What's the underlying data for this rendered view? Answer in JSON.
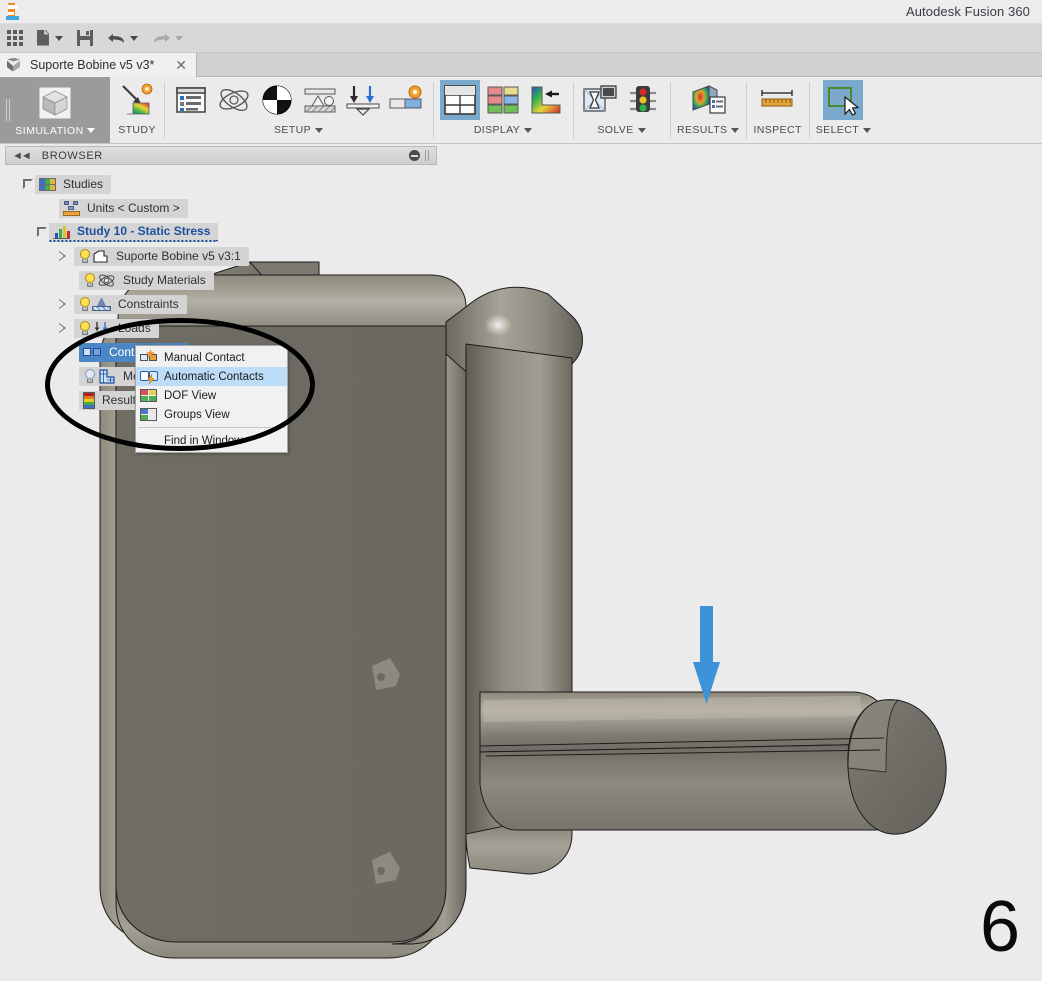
{
  "app": {
    "title": "Autodesk Fusion 360",
    "logo_icon": "fusion-logo-icon"
  },
  "quick_access": {
    "items": [
      {
        "name": "app-grid-button",
        "icon": "grid-icon",
        "label": ""
      },
      {
        "name": "new-document-button",
        "icon": "document-icon",
        "label": "",
        "has_dropdown": true
      },
      {
        "name": "save-button",
        "icon": "save-icon",
        "label": ""
      },
      {
        "name": "undo-button",
        "icon": "undo-arrow-icon",
        "label": "",
        "has_dropdown": true
      },
      {
        "name": "redo-button",
        "icon": "redo-arrow-icon",
        "label": "",
        "has_dropdown": true
      }
    ]
  },
  "tabs": [
    {
      "label": "Suporte Bobine v5 v3*",
      "close_label": "✕",
      "active": true
    }
  ],
  "ribbon": {
    "workspace": {
      "label": "SIMULATION",
      "icon": "cube-icon",
      "has_dropdown": true
    },
    "groups": [
      {
        "label": "STUDY",
        "has_dropdown": false,
        "buttons": [
          {
            "name": "new-study-button",
            "icon": "study-icon"
          }
        ]
      },
      {
        "label": "SETUP",
        "has_dropdown": true,
        "buttons": [
          {
            "name": "simplify-button",
            "icon": "list-panel-icon"
          },
          {
            "name": "study-materials-button",
            "icon": "atom-icon"
          },
          {
            "name": "contacts-button",
            "icon": "contact-sphere-icon"
          },
          {
            "name": "constraints-button",
            "icon": "constraint-icon"
          },
          {
            "name": "loads-button",
            "icon": "load-arrows-icon"
          },
          {
            "name": "manage-button",
            "icon": "manage-icon"
          }
        ]
      },
      {
        "label": "DISPLAY",
        "has_dropdown": true,
        "buttons": [
          {
            "name": "mesh-visibility-button",
            "icon": "grid-panel-icon",
            "selected": true
          },
          {
            "name": "color-display-button",
            "icon": "color-blocks-icon"
          },
          {
            "name": "legend-display-button",
            "icon": "legend-arrow-icon"
          }
        ]
      },
      {
        "label": "SOLVE",
        "has_dropdown": true,
        "buttons": [
          {
            "name": "pre-check-button",
            "icon": "hourglass-monitor-icon"
          },
          {
            "name": "solve-status-button",
            "icon": "traffic-light-icon"
          }
        ]
      },
      {
        "label": "RESULTS",
        "has_dropdown": true,
        "buttons": [
          {
            "name": "results-button",
            "icon": "results-contour-icon"
          }
        ]
      },
      {
        "label": "INSPECT",
        "has_dropdown": false,
        "buttons": [
          {
            "name": "measure-button",
            "icon": "ruler-icon"
          }
        ]
      },
      {
        "label": "SELECT",
        "has_dropdown": true,
        "buttons": [
          {
            "name": "select-button",
            "icon": "selection-cursor-icon",
            "selected": true
          }
        ]
      }
    ]
  },
  "browser": {
    "header": {
      "title": "BROWSER",
      "collapse_icon": "collapse-left-icon",
      "minimize_icon": "minimize-icon"
    },
    "tree": [
      {
        "label": "Studies",
        "indent": 0,
        "expander": "down",
        "icon": "studies-icon",
        "bulb": "none",
        "state": "normal"
      },
      {
        "label": "Units < Custom >",
        "indent": 1,
        "expander": "none",
        "icon": "units-icon",
        "bulb": "none",
        "state": "normal"
      },
      {
        "label": "Study 10 - Static Stress",
        "indent": 0,
        "expander": "down",
        "icon": "study-chart-icon",
        "bulb": "none",
        "state": "active"
      },
      {
        "label": "Suporte Bobine v5 v3:1",
        "indent": 2,
        "expander": "right",
        "icon": "body-icon",
        "bulb": "on",
        "state": "normal"
      },
      {
        "label": "Study Materials",
        "indent": 2,
        "expander": "none",
        "icon": "material-atom-icon",
        "bulb": "on",
        "state": "normal"
      },
      {
        "label": "Constraints",
        "indent": 2,
        "expander": "right",
        "icon": "constraint-icon",
        "bulb": "on",
        "state": "normal"
      },
      {
        "label": "Loads",
        "indent": 2,
        "expander": "right",
        "icon": "loads-icon",
        "bulb": "on",
        "state": "normal"
      },
      {
        "label": "Contacts",
        "indent": 2,
        "expander": "none",
        "icon": "contacts-icon",
        "bulb": "none",
        "state": "selected"
      },
      {
        "label": "Mesh",
        "indent": 2,
        "expander": "none",
        "icon": "mesh-icon",
        "bulb": "off",
        "state": "normal"
      },
      {
        "label": "Results",
        "indent": 2,
        "expander": "none",
        "icon": "results-legend-icon",
        "bulb": "none",
        "state": "normal"
      }
    ]
  },
  "context_menu": {
    "items": [
      {
        "label": "Manual Contact",
        "icon": "manual-contact-icon",
        "highlighted": false,
        "separator_after": false
      },
      {
        "label": "Automatic Contacts",
        "icon": "automatic-contacts-icon",
        "highlighted": true,
        "separator_after": false
      },
      {
        "label": "DOF View",
        "icon": "dof-view-icon",
        "highlighted": false,
        "separator_after": false
      },
      {
        "label": "Groups View",
        "icon": "groups-view-icon",
        "highlighted": false,
        "separator_after": true
      },
      {
        "label": "Find in Window",
        "icon": "",
        "highlighted": false,
        "separator_after": false
      }
    ]
  },
  "viewport": {
    "background_color": "#ebebeb",
    "model_name": "Suporte Bobine v5 v3",
    "model_body_color": "#6b6961",
    "load_arrow": {
      "name": "load-arrow",
      "color": "#3d93d9",
      "direction": "down"
    },
    "annotation_ellipse": {
      "name": "annotation-ellipse",
      "color": "#000000"
    },
    "page_number": "6"
  }
}
